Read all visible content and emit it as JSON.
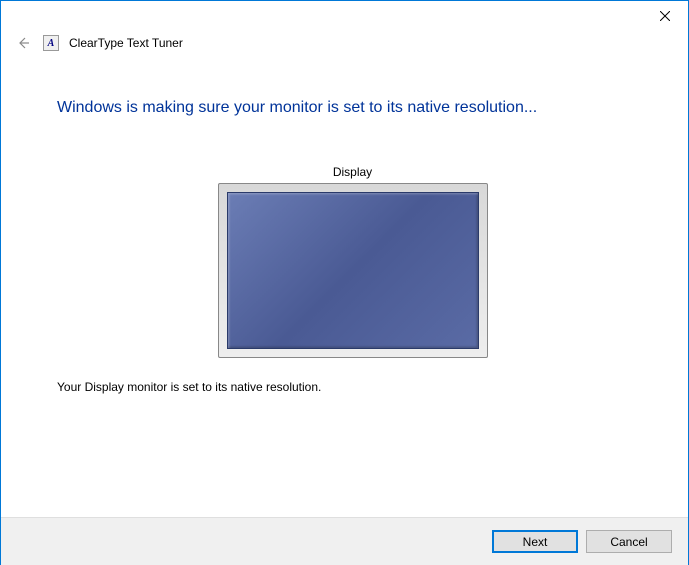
{
  "titlebar": {
    "close_label": "Close"
  },
  "header": {
    "app_title": "ClearType Text Tuner",
    "icon_letter": "A"
  },
  "content": {
    "heading": "Windows is making sure your monitor is set to its native resolution...",
    "monitor_label": "Display",
    "status_text": "Your Display monitor is set to its native resolution."
  },
  "footer": {
    "next_label": "Next",
    "cancel_label": "Cancel"
  }
}
